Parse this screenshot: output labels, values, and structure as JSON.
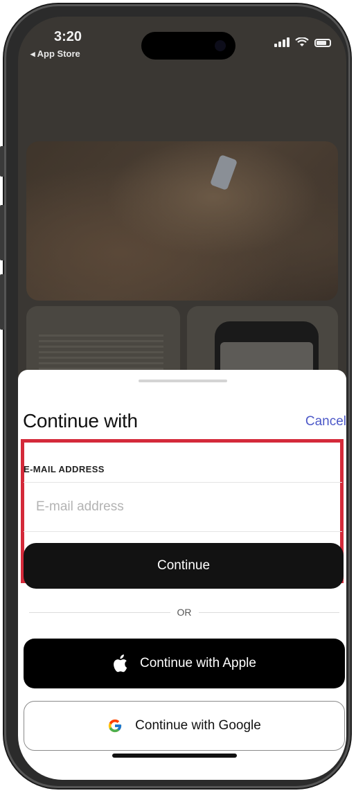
{
  "status_bar": {
    "time": "3:20",
    "back_label": "◂ App Store"
  },
  "sheet": {
    "title": "Continue with",
    "cancel_label": "Cancel",
    "email_label": "E-MAIL ADDRESS",
    "email_placeholder": "E-mail address",
    "email_value": "",
    "continue_label": "Continue",
    "or_label": "OR",
    "apple_label": "Continue with Apple",
    "google_label": "Continue with Google"
  },
  "colors": {
    "accent_link": "#4d59c8",
    "highlight_border": "#d42a3a",
    "primary_button": "#121212"
  },
  "icons": {
    "apple": "apple-logo-icon",
    "google": "google-logo-icon",
    "wifi": "wifi-icon",
    "battery": "battery-icon",
    "signal": "cellular-signal-icon"
  }
}
